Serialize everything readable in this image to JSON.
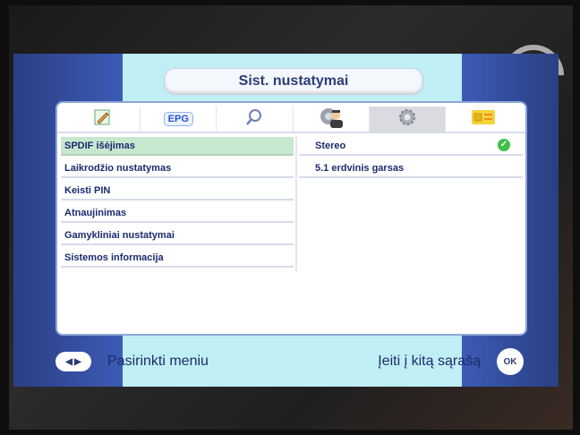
{
  "title": "Sist. nustatymai",
  "tabs": [
    {
      "name": "edit",
      "icon": "pencil-icon"
    },
    {
      "name": "epg",
      "label": "EPG"
    },
    {
      "name": "search",
      "icon": "magnifier-icon"
    },
    {
      "name": "install",
      "icon": "technician-icon"
    },
    {
      "name": "settings",
      "icon": "gear-icon"
    },
    {
      "name": "card",
      "icon": "smartcard-icon"
    }
  ],
  "menu": [
    "SPDIF išėjimas",
    "Laikrodžio nustatymas",
    "Keisti PIN",
    "Atnaujinimas",
    "Gamykliniai nustatymai",
    "Sistemos informacija"
  ],
  "options": [
    "Stereo",
    "5.1 erdvinis garsas"
  ],
  "footer": {
    "left_label": "Pasirinkti meniu",
    "right_label": "Įeiti į kitą sąrašą",
    "ok_label": "OK"
  }
}
